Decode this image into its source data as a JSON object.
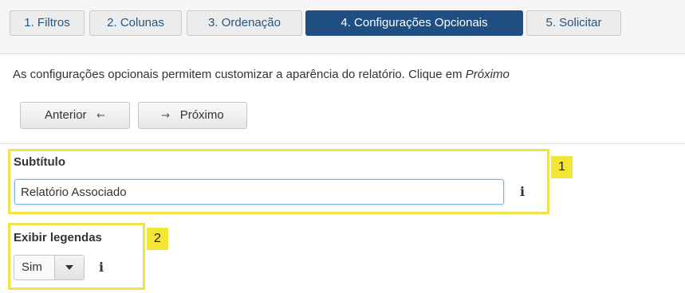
{
  "tabs": [
    {
      "label": "1. Filtros"
    },
    {
      "label": "2. Colunas"
    },
    {
      "label": "3. Ordenação"
    },
    {
      "label": "4. Configurações Opcionais"
    },
    {
      "label": "5. Solicitar"
    }
  ],
  "info": {
    "text": "As configurações opcionais permitem customizar a aparência do relatório. Clique em ",
    "emphasis": "Próximo"
  },
  "nav": {
    "previous_label": "Anterior",
    "previous_arrow": "←",
    "next_arrow": "→",
    "next_label": "Próximo"
  },
  "subtitle_field": {
    "label": "Subtítulo",
    "value": "Relatório Associado",
    "info_glyph": "i"
  },
  "legend_field": {
    "label": "Exibir legendas",
    "selected": "Sim",
    "info_glyph": "i"
  },
  "callouts": [
    "1",
    "2"
  ],
  "icons": {
    "info": "info-icon",
    "dropdown": "caret-down-icon",
    "previous": "arrow-left-icon",
    "next": "arrow-right-icon"
  },
  "colors": {
    "active_tab": "#1f4f82",
    "tab_text": "#27557f",
    "highlight": "#f1e24a",
    "input_focus": "#7fb0dd"
  }
}
